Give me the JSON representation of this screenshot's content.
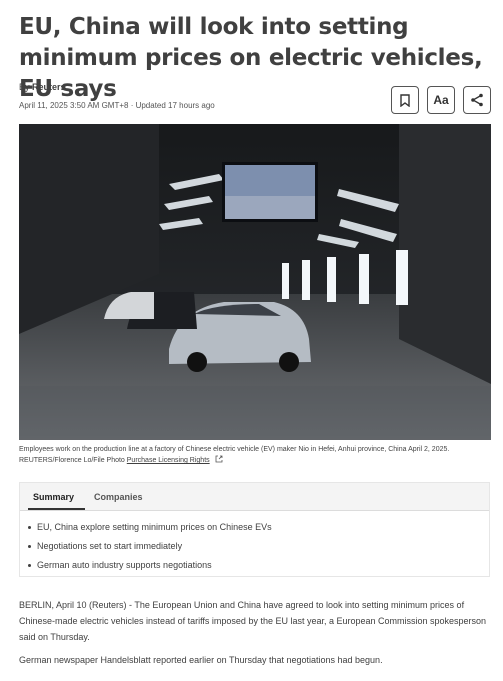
{
  "article": {
    "headline": "EU, China will look into setting minimum prices on electric vehicles, EU says",
    "byline_prefix": "By ",
    "byline_author": "Reuters",
    "dateline": "April 11, 2025 3:50 AM GMT+8 · Updated 17 hours ago"
  },
  "toolbar": {
    "bookmark_icon": "bookmark-icon",
    "font_size_label": "Aa",
    "share_icon": "share-icon"
  },
  "hero": {
    "screen_color": "#7d8fae",
    "caption": "Employees work on the production line at a factory of Chinese electric vehicle (EV) maker Nio in Hefei, Anhui province, China April 2, 2025. REUTERS/Florence Lo/File Photo ",
    "licensing_link": "Purchase Licensing Rights",
    "external_link_icon": "external-link-icon"
  },
  "summary": {
    "tabs": [
      "Summary",
      "Companies"
    ],
    "bullets": [
      "EU, China explore setting minimum prices on Chinese EVs",
      "Negotiations set to start immediately",
      "German auto industry supports negotiations"
    ]
  },
  "body": {
    "paragraphs": [
      "BERLIN, April 10 (Reuters) - The European Union and China have agreed to look into setting minimum prices of Chinese-made electric vehicles instead of tariffs imposed by the EU last year, a European Commission spokesperson said on Thursday.",
      "German newspaper Handelsblatt reported earlier on Thursday that negotiations had begun."
    ]
  }
}
